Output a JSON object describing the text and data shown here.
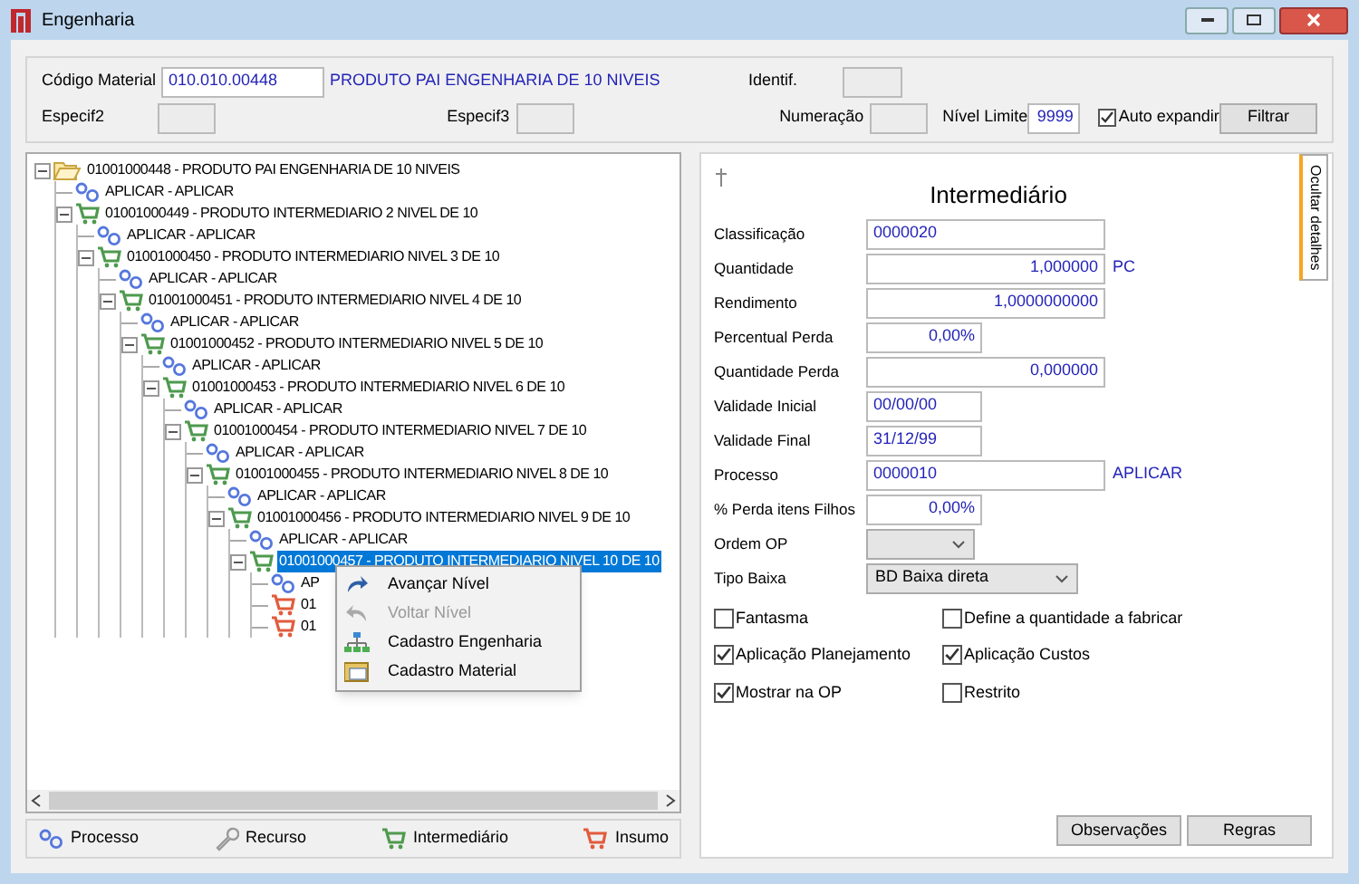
{
  "window": {
    "title": "Engenharia"
  },
  "filter": {
    "codigo_label": "Código Material",
    "codigo_value": "010.010.00448",
    "codigo_desc": "PRODUTO PAI ENGENHARIA DE 10 NIVEIS",
    "identif_label": "Identif.",
    "especif2_label": "Especif2",
    "especif3_label": "Especif3",
    "numeracao_label": "Numeração",
    "nivel_label": "Nível Limite",
    "nivel_value": "9999",
    "auto_label": "Auto expandir",
    "auto_checked": true,
    "filter_button": "Filtrar"
  },
  "tree": [
    {
      "kind": "folder",
      "label": "01001000448 - PRODUTO PAI ENGENHARIA DE 10 NIVEIS",
      "selected": false,
      "expanded": true,
      "children": [
        {
          "kind": "process",
          "label": "APLICAR - APLICAR",
          "selected": false
        },
        {
          "kind": "intermediate",
          "label": "01001000449 - PRODUTO INTERMEDIARIO 2 NIVEL DE 10",
          "selected": false,
          "expanded": true,
          "children": [
            {
              "kind": "process",
              "label": "APLICAR - APLICAR",
              "selected": false
            },
            {
              "kind": "intermediate",
              "label": "01001000450 - PRODUTO INTERMEDIARIO NIVEL 3 DE 10",
              "selected": false,
              "expanded": true,
              "children": [
                {
                  "kind": "process",
                  "label": "APLICAR - APLICAR",
                  "selected": false
                },
                {
                  "kind": "intermediate",
                  "label": "01001000451 - PRODUTO INTERMEDIARIO NIVEL 4 DE 10",
                  "selected": false,
                  "expanded": true,
                  "children": [
                    {
                      "kind": "process",
                      "label": "APLICAR - APLICAR",
                      "selected": false
                    },
                    {
                      "kind": "intermediate",
                      "label": "01001000452 - PRODUTO INTERMEDIARIO NIVEL 5 DE 10",
                      "selected": false,
                      "expanded": true,
                      "children": [
                        {
                          "kind": "process",
                          "label": "APLICAR - APLICAR",
                          "selected": false
                        },
                        {
                          "kind": "intermediate",
                          "label": "01001000453 - PRODUTO INTERMEDIARIO NIVEL 6 DE 10",
                          "selected": false,
                          "expanded": true,
                          "children": [
                            {
                              "kind": "process",
                              "label": "APLICAR - APLICAR",
                              "selected": false
                            },
                            {
                              "kind": "intermediate",
                              "label": "01001000454 - PRODUTO INTERMEDIARIO NIVEL 7 DE 10",
                              "selected": false,
                              "expanded": true,
                              "children": [
                                {
                                  "kind": "process",
                                  "label": "APLICAR - APLICAR",
                                  "selected": false
                                },
                                {
                                  "kind": "intermediate",
                                  "label": "01001000455 - PRODUTO INTERMEDIARIO NIVEL 8 DE 10",
                                  "selected": false,
                                  "expanded": true,
                                  "children": [
                                    {
                                      "kind": "process",
                                      "label": "APLICAR - APLICAR",
                                      "selected": false
                                    },
                                    {
                                      "kind": "intermediate",
                                      "label": "01001000456 - PRODUTO INTERMEDIARIO NIVEL 9 DE 10",
                                      "selected": false,
                                      "expanded": true,
                                      "children": [
                                        {
                                          "kind": "process",
                                          "label": "APLICAR - APLICAR",
                                          "selected": false
                                        },
                                        {
                                          "kind": "intermediate",
                                          "label": "01001000457 - PRODUTO INTERMEDIARIO NIVEL 10 DE 10",
                                          "selected": true,
                                          "expanded": true,
                                          "children": [
                                            {
                                              "kind": "process",
                                              "label": "AP",
                                              "selected": false
                                            },
                                            {
                                              "kind": "insumo",
                                              "label": "01",
                                              "selected": false
                                            },
                                            {
                                              "kind": "insumo",
                                              "label": "01",
                                              "selected": false
                                            }
                                          ]
                                        }
                                      ]
                                    }
                                  ]
                                }
                              ]
                            }
                          ]
                        }
                      ]
                    }
                  ]
                }
              ]
            }
          ]
        }
      ]
    }
  ],
  "context_menu": [
    {
      "kind": "forward",
      "label": "Avançar Nível",
      "disabled": false
    },
    {
      "kind": "back",
      "label": "Voltar Nível",
      "disabled": true
    },
    {
      "kind": "org",
      "label": "Cadastro Engenharia",
      "disabled": false
    },
    {
      "kind": "material",
      "label": "Cadastro Material",
      "disabled": false
    }
  ],
  "legend": [
    {
      "kind": "process",
      "label": "Processo"
    },
    {
      "kind": "resource",
      "label": "Recurso"
    },
    {
      "kind": "intermediate",
      "label": "Intermediário"
    },
    {
      "kind": "insumo",
      "label": "Insumo"
    }
  ],
  "details": {
    "title": "Intermediário",
    "hide_tab": "Ocultar detalhes",
    "fields": [
      {
        "kind": "text",
        "label": "Classificação",
        "value": "0000020"
      },
      {
        "kind": "text",
        "label": "Quantidade",
        "value": "1,000000",
        "suffix": "PC"
      },
      {
        "kind": "text",
        "label": "Rendimento",
        "value": "1,0000000000"
      },
      {
        "kind": "text",
        "label": "Percentual Perda",
        "value": "0,00%"
      },
      {
        "kind": "text",
        "label": "Quantidade Perda",
        "value": "0,000000"
      },
      {
        "kind": "text",
        "label": "Validade Inicial",
        "value": "00/00/00"
      },
      {
        "kind": "text",
        "label": "Validade Final",
        "value": "31/12/99"
      },
      {
        "kind": "text",
        "label": "Processo",
        "value": "0000010",
        "suffix": "APLICAR"
      },
      {
        "kind": "text",
        "label": "% Perda itens Filhos",
        "value": "0,00%"
      },
      {
        "kind": "select",
        "label": "Ordem OP"
      },
      {
        "kind": "select",
        "label": "Tipo Baixa",
        "value": "BD Baixa direta"
      }
    ],
    "checkboxes": [
      {
        "label": "Fantasma",
        "checked": false
      },
      {
        "label": "Define a quantidade a fabricar",
        "checked": false
      },
      {
        "label": "Aplicação Planejamento",
        "checked": true
      },
      {
        "label": "Aplicação Custos",
        "checked": true
      },
      {
        "label": "Mostrar na OP",
        "checked": true
      },
      {
        "label": "Restrito",
        "checked": false
      }
    ],
    "buttons": [
      "Observações",
      "Regras"
    ]
  }
}
